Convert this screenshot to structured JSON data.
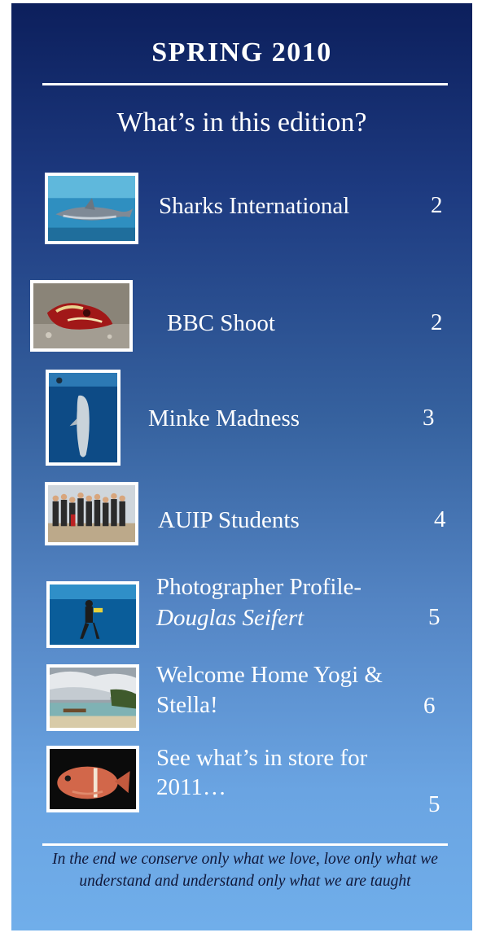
{
  "header": {
    "title": "SPRING 2010",
    "subtitle": "What’s in this edition?"
  },
  "items": [
    {
      "label": "Sharks International",
      "page": "2",
      "image": "shark-photo"
    },
    {
      "label": "BBC Shoot",
      "page": "2",
      "image": "flamboyant-cuttlefish-photo"
    },
    {
      "label": "Minke Madness",
      "page": "3",
      "image": "minke-whale-photo"
    },
    {
      "label": "AUIP Students",
      "page": "4",
      "image": "students-group-photo"
    },
    {
      "label": "Photographer Profile-",
      "label_italic": "Douglas Seifert",
      "page": "5",
      "image": "diver-photo"
    },
    {
      "label": "Welcome Home Yogi &",
      "label_line2": "Stella!",
      "page": "6",
      "image": "island-beach-photo"
    },
    {
      "label": "See what’s in store for",
      "label_line2": "2011…",
      "page": "5",
      "image": "anemonefish-photo"
    }
  ],
  "footer": {
    "quote": "In the end we conserve only what we love, love only what we understand and understand only what we are taught"
  },
  "colors": {
    "panel_top": "#0c1f5c",
    "panel_bottom": "#70aeea",
    "text": "#ffffff",
    "quote_text": "#10183a"
  }
}
